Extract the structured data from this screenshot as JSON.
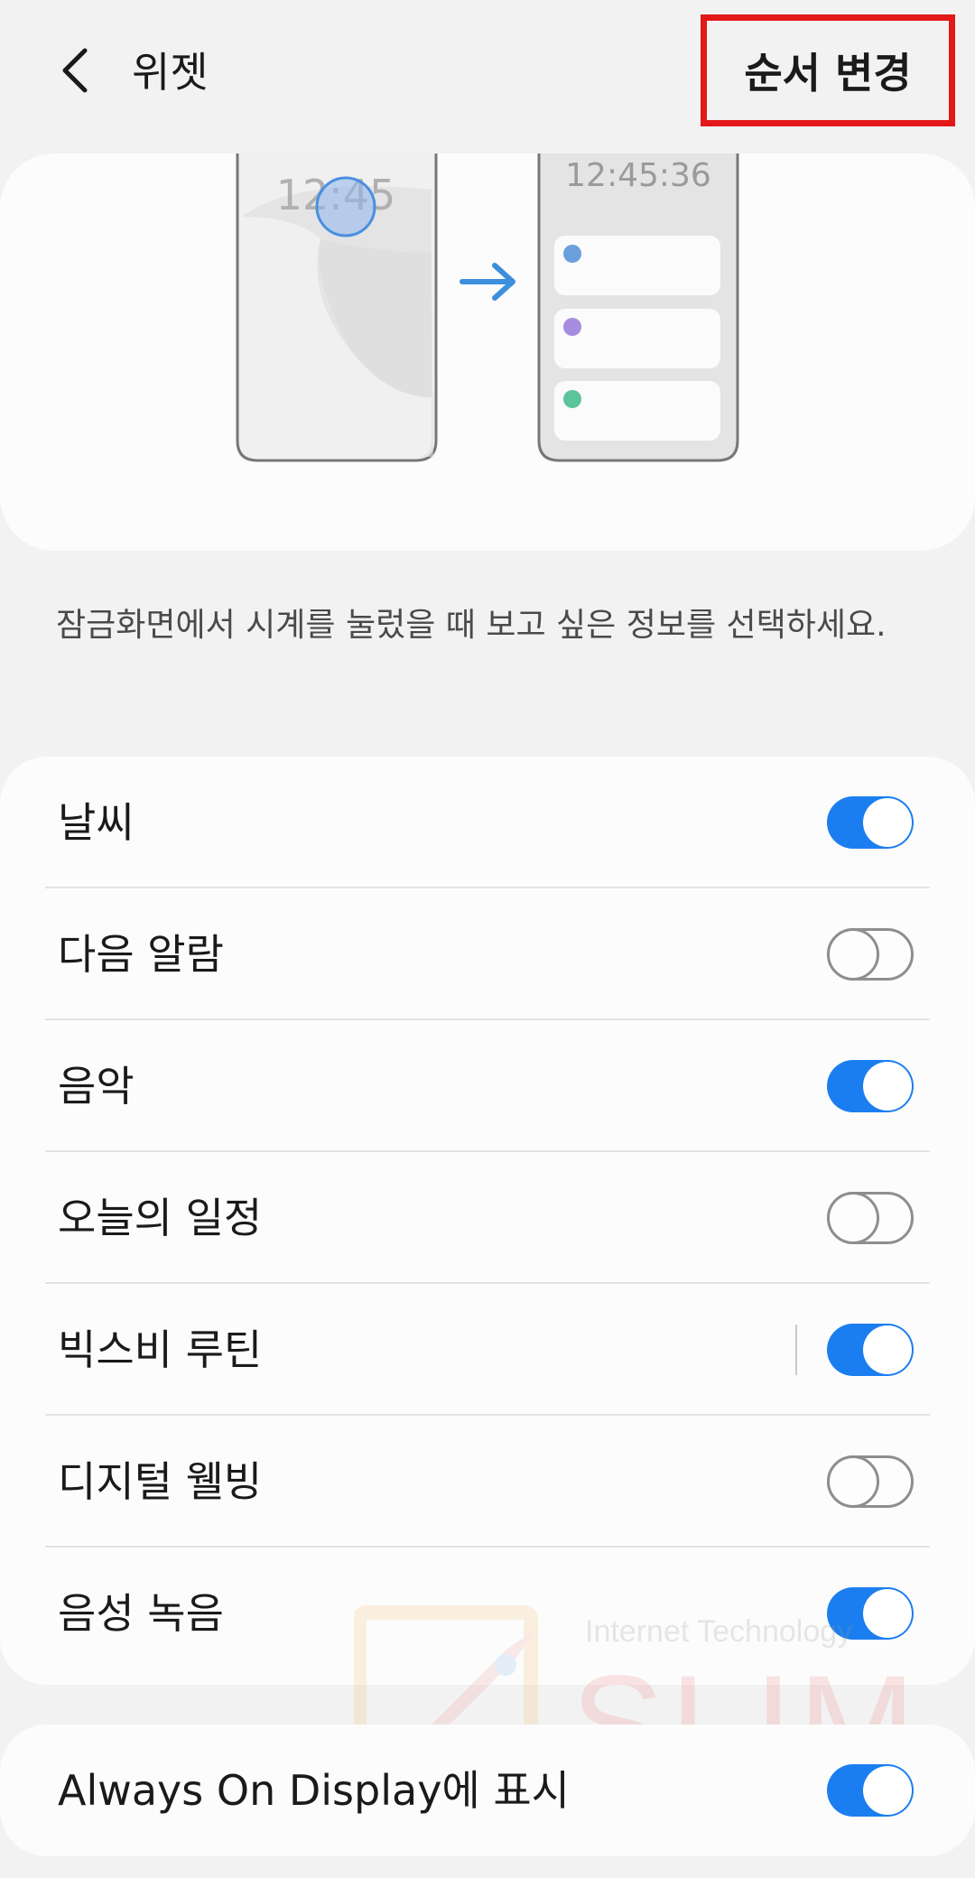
{
  "header": {
    "title": "위젯",
    "reorder_label": "순서 변경"
  },
  "illustration": {
    "lock_clock": "12:45",
    "widget_clock": "12:45:36",
    "dot_colors": [
      "#6a9fdc",
      "#a78de0",
      "#5cc49a"
    ]
  },
  "description": "잠금화면에서 시계를 눌렀을 때 보고 싶은 정보를 선택하세요.",
  "items": [
    {
      "label": "날씨",
      "on": true
    },
    {
      "label": "다음 알람",
      "on": false
    },
    {
      "label": "음악",
      "on": true
    },
    {
      "label": "오늘의 일정",
      "on": false
    },
    {
      "label": "빅스비 루틴",
      "on": true
    },
    {
      "label": "디지털 웰빙",
      "on": false
    },
    {
      "label": "음성 녹음",
      "on": true
    }
  ],
  "aod": {
    "label": "Always On Display에 표시",
    "on": true
  },
  "watermark": {
    "top": "Internet Technology",
    "big": "SLIM"
  },
  "colors": {
    "accent": "#1b7ef0",
    "highlight": "#e31919",
    "background": "#f2f2f2"
  }
}
